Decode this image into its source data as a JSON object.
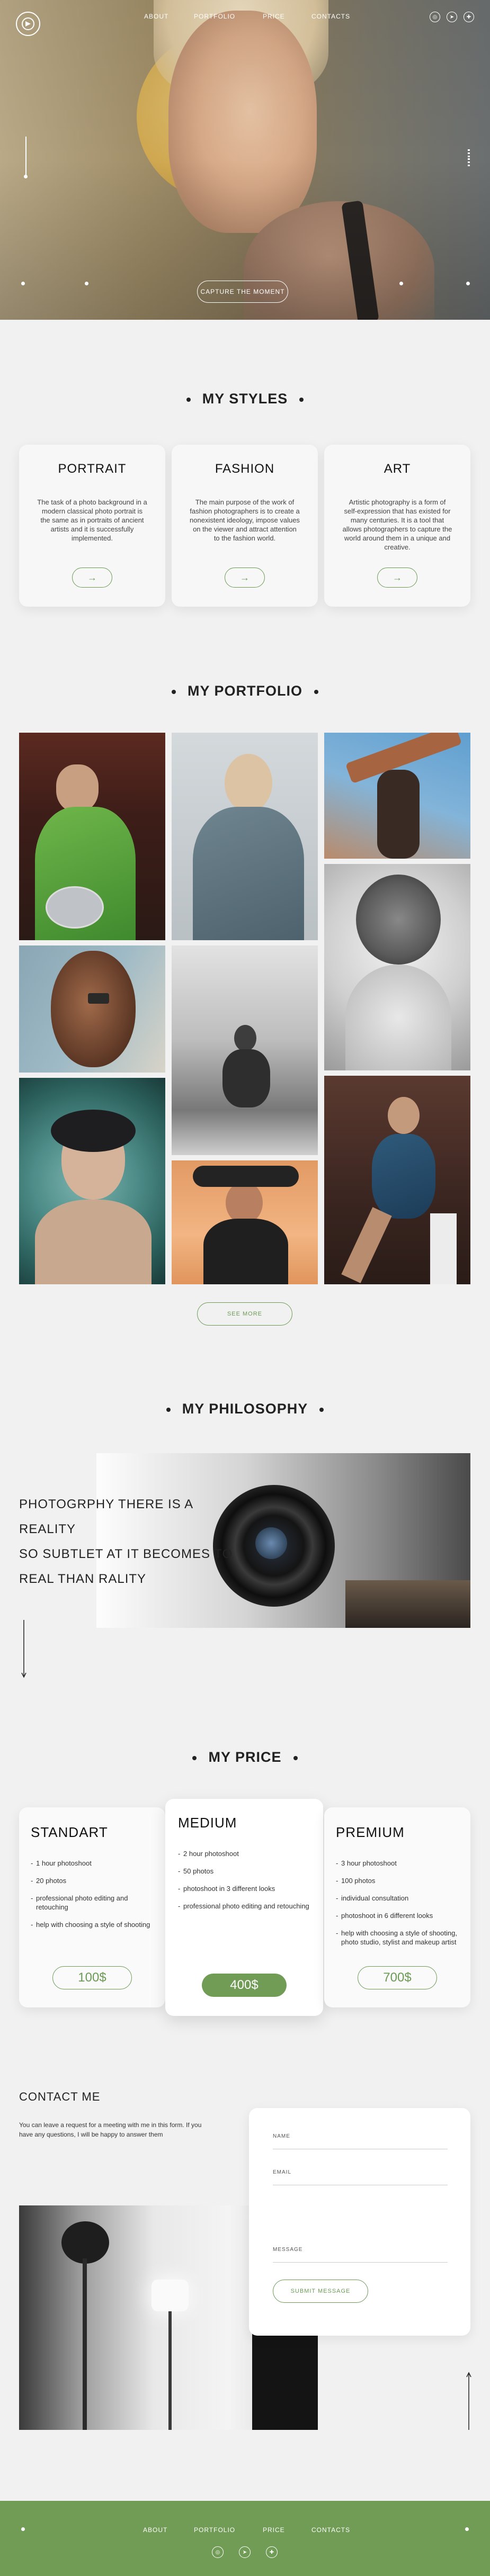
{
  "nav": {
    "items": [
      "ABOUT",
      "PORTFOLIO",
      "PRICE",
      "CONTACTS"
    ]
  },
  "hero": {
    "cta_label": "CAPTURE THE MOMENT"
  },
  "styles": {
    "title": "MY STYLES",
    "cards": [
      {
        "title": "PORTRAIT",
        "text": "The task of a photo background in a modern classical photo portrait is the same as in portraits of ancient artists and it is successfully implemented.",
        "button": "→"
      },
      {
        "title": "FASHION",
        "text": "The main purpose of the work of fashion photographers is to create a nonexistent ideology, impose values on the viewer and attract attention to the fashion world.",
        "button": "→"
      },
      {
        "title": "ART",
        "text": "Artistic photography is a form of self-expression that has existed for many centuries. It is a tool that allows photographers to capture the world around them in a unique and creative.",
        "button": "→"
      }
    ]
  },
  "portfolio": {
    "title": "MY PORTFOLIO",
    "see_more": "SEE MORE"
  },
  "philosophy": {
    "title": "MY PHILOSOPHY",
    "lines": [
      "PHOTOGRPHY THERE IS A REALITY",
      "SO SUBTLET AT IT BECOMES TO",
      "REAL THAN RALITY"
    ]
  },
  "price": {
    "title": "MY PRICE",
    "plans": [
      {
        "name": "STANDART",
        "items": [
          "1 hour photoshoot",
          "20 photos",
          "professional photo editing and retouching",
          "help with choosing a style of shooting"
        ],
        "price": "100$"
      },
      {
        "name": "MEDIUM",
        "items": [
          "2 hour photoshoot",
          "50 photos",
          "photoshoot in 3 different looks",
          "professional photo editing and retouching"
        ],
        "price": "400$"
      },
      {
        "name": "PREMIUM",
        "items": [
          "3 hour photoshoot",
          "100 photos",
          "individual consultation",
          "photoshoot in 6 different looks",
          "help with choosing a style of shooting, photo studio, stylist and makeup artist"
        ],
        "price": "700$"
      }
    ]
  },
  "contact": {
    "title": "CONTACT ME",
    "text": "You can leave a request for a meeting with me in this form. If you have any questions, I will be happy to answer them",
    "fields": {
      "name": "NAME",
      "email": "EMAIL",
      "message": "MESSAGE"
    },
    "submit": "SUBMIT MESSAGE"
  },
  "footer": {
    "items": [
      "ABOUT",
      "PORTFOLIO",
      "PRICE",
      "CONTACTS"
    ]
  },
  "colors": {
    "accent": "#719c55",
    "background": "#f1f1f1"
  },
  "icons": [
    "camera-aperture-logo",
    "instagram-icon",
    "telegram-icon",
    "vk-icon",
    "arrow-right-icon",
    "arrow-down-icon",
    "arrow-up-icon"
  ]
}
